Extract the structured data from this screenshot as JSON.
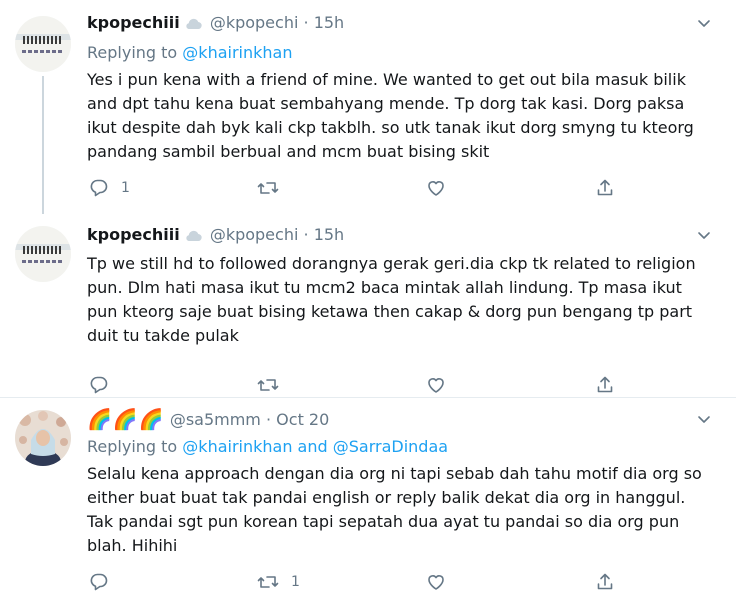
{
  "tweets": [
    {
      "name": "kpopechiii",
      "handle": "@kpopechi",
      "dot": "·",
      "time": "15h",
      "replying_prefix": "Replying to ",
      "replying_users": [
        "@khairinkhan"
      ],
      "text": "Yes i pun kena with a friend of mine. We wanted to get out bila masuk bilik and dpt tahu kena buat sembahyang mende. Tp dorg tak kasi. Dorg paksa ikut despite dah byk kali ckp takblh. so utk tanak ikut dorg smyng tu kteorg pandang sambil berbual and mcm buat bising skit",
      "reply_count": "1",
      "retweet_count": "",
      "like_count": ""
    },
    {
      "name": "kpopechiii",
      "handle": "@kpopechi",
      "dot": "·",
      "time": "15h",
      "text": "Tp we still hd to followed dorangnya gerak geri.dia ckp tk related to religion pun. Dlm hati masa ikut tu mcm2 baca mintak allah lindung. Tp masa ikut pun kteorg saje buat bising ketawa then cakap & dorg pun bengang tp part duit tu takde pulak",
      "reply_count": "",
      "retweet_count": "",
      "like_count": ""
    },
    {
      "name": "🌈🌈🌈",
      "handle": "@sa5mmm",
      "dot": "·",
      "time": "Oct 20",
      "replying_prefix": "Replying to ",
      "replying_users": [
        "@khairinkhan",
        "@SarraDindaa"
      ],
      "replying_and": " and ",
      "text": "Selalu kena approach dengan dia org ni tapi sebab dah tahu motif dia org so either buat buat tak pandai english or reply balik dekat dia org in hanggul. Tak pandai sgt pun korean tapi sepatah dua ayat tu pandai so dia org pun blah. Hihihi",
      "reply_count": "",
      "retweet_count": "1",
      "like_count": ""
    }
  ],
  "icons": {
    "reply": "reply-icon",
    "retweet": "retweet-icon",
    "like": "heart-icon",
    "share": "share-icon",
    "cloud": "cloud-icon",
    "caret": "chevron-down-icon"
  },
  "colors": {
    "link": "#1da1f2",
    "muted": "#657786",
    "text": "#14171a",
    "divider": "#e6ecf0"
  }
}
